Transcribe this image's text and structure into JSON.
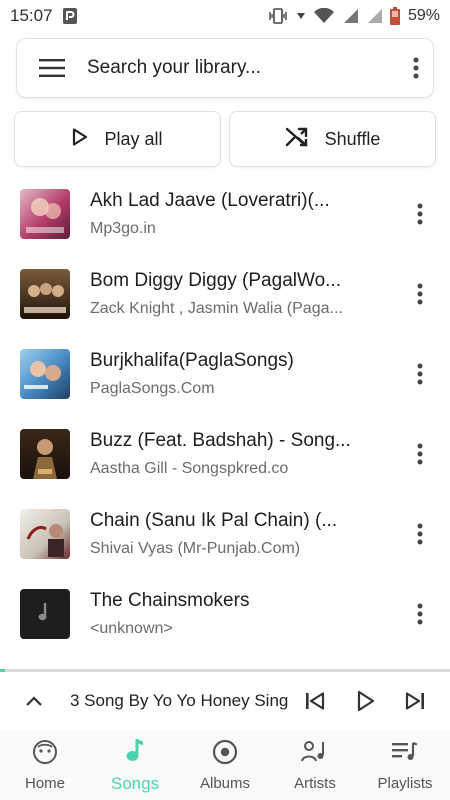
{
  "status_bar": {
    "time": "15:07",
    "battery": "59%"
  },
  "search": {
    "placeholder": "Search your library..."
  },
  "actions": {
    "play_all": "Play all",
    "shuffle": "Shuffle"
  },
  "songs": [
    {
      "title": "Akh Lad Jaave (Loveratri)(...",
      "subtitle": "Mp3go.in"
    },
    {
      "title": "Bom Diggy Diggy (PagalWo...",
      "subtitle": "Zack Knight , Jasmin Walia (Paga..."
    },
    {
      "title": "Burjkhalifa(PaglaSongs)",
      "subtitle": "PaglaSongs.Com"
    },
    {
      "title": "Buzz (Feat. Badshah) - Song...",
      "subtitle": "Aastha Gill - Songspkred.co"
    },
    {
      "title": "Chain (Sanu Ik Pal Chain) (...",
      "subtitle": "Shivai Vyas (Mr-Punjab.Com)"
    },
    {
      "title": "The Chainsmokers",
      "subtitle": "<unknown>"
    }
  ],
  "mini_player": {
    "now_playing": "3 Song By Yo Yo Honey Sing",
    "progress": 0.01
  },
  "nav": {
    "home": "Home",
    "songs": "Songs",
    "albums": "Albums",
    "artists": "Artists",
    "playlists": "Playlists",
    "active": "songs"
  },
  "colors": {
    "accent": "#4fd1ad",
    "text": "#212121",
    "subtext": "#6b6b6b"
  }
}
